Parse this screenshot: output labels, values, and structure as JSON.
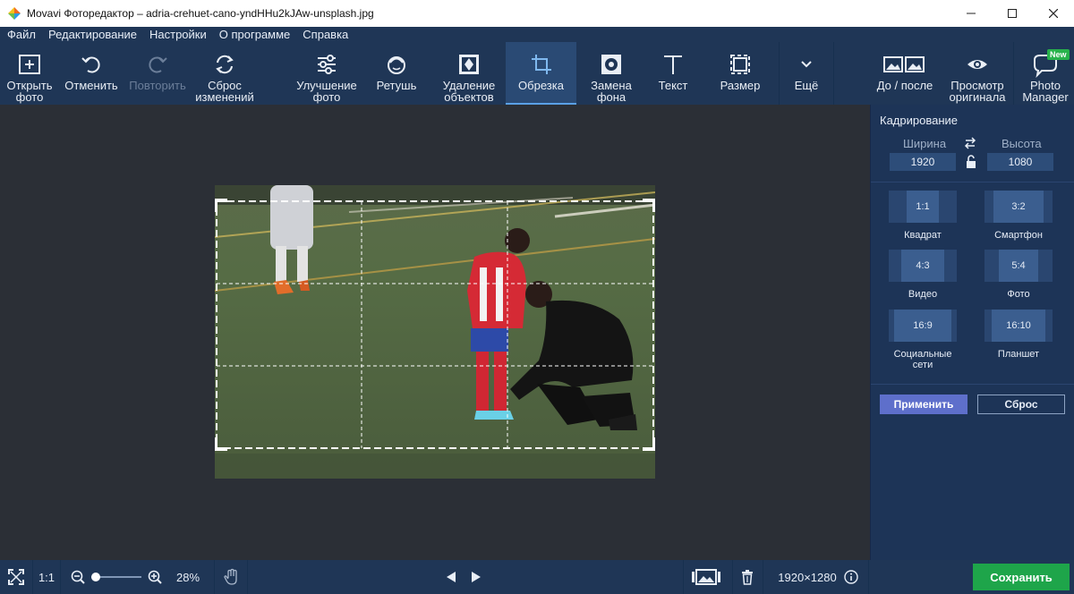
{
  "window": {
    "title": "Movavi Фоторедактор – adria-crehuet-cano-yndHHu2kJAw-unsplash.jpg",
    "minimize_icon": "minimize-icon",
    "maximize_icon": "maximize-icon",
    "close_icon": "close-icon"
  },
  "menu": [
    "Файл",
    "Редактирование",
    "Настройки",
    "О программе",
    "Справка"
  ],
  "toolbar": {
    "open": "Открыть\nфото",
    "undo": "Отменить",
    "redo": "Повторить",
    "reset": "Сброс\nизменений",
    "enhance": "Улучшение\nфото",
    "retouch": "Ретушь",
    "remove": "Удаление\nобъектов",
    "crop": "Обрезка",
    "bg": "Замена\nфона",
    "text": "Текст",
    "resize": "Размер",
    "more": "Ещё",
    "before_after": "До / после",
    "preview": "Просмотр\nоригинала",
    "photo_manager": "Photo\nManager",
    "new_badge": "New"
  },
  "crop_panel": {
    "title": "Кадрирование",
    "width_label": "Ширина",
    "height_label": "Высота",
    "width_value": "1920",
    "height_value": "1080",
    "ratios": [
      {
        "ratio": "1:1",
        "name": "Квадрат"
      },
      {
        "ratio": "3:2",
        "name": "Смартфон"
      },
      {
        "ratio": "4:3",
        "name": "Видео"
      },
      {
        "ratio": "5:4",
        "name": "Фото"
      },
      {
        "ratio": "16:9",
        "name": "Социальные\nсети"
      },
      {
        "ratio": "16:10",
        "name": "Планшет"
      }
    ],
    "apply": "Применить",
    "reset": "Сброс"
  },
  "statusbar": {
    "one_to_one": "1:1",
    "zoom": "28%",
    "dimensions": "1920×1280",
    "save": "Сохранить"
  },
  "colors": {
    "toolbar_bg": "#1f3656",
    "canvas_bg": "#2b2f36",
    "apply_btn": "#5e6fcb",
    "save_btn": "#1ea54a",
    "new_badge": "#28b24b"
  }
}
